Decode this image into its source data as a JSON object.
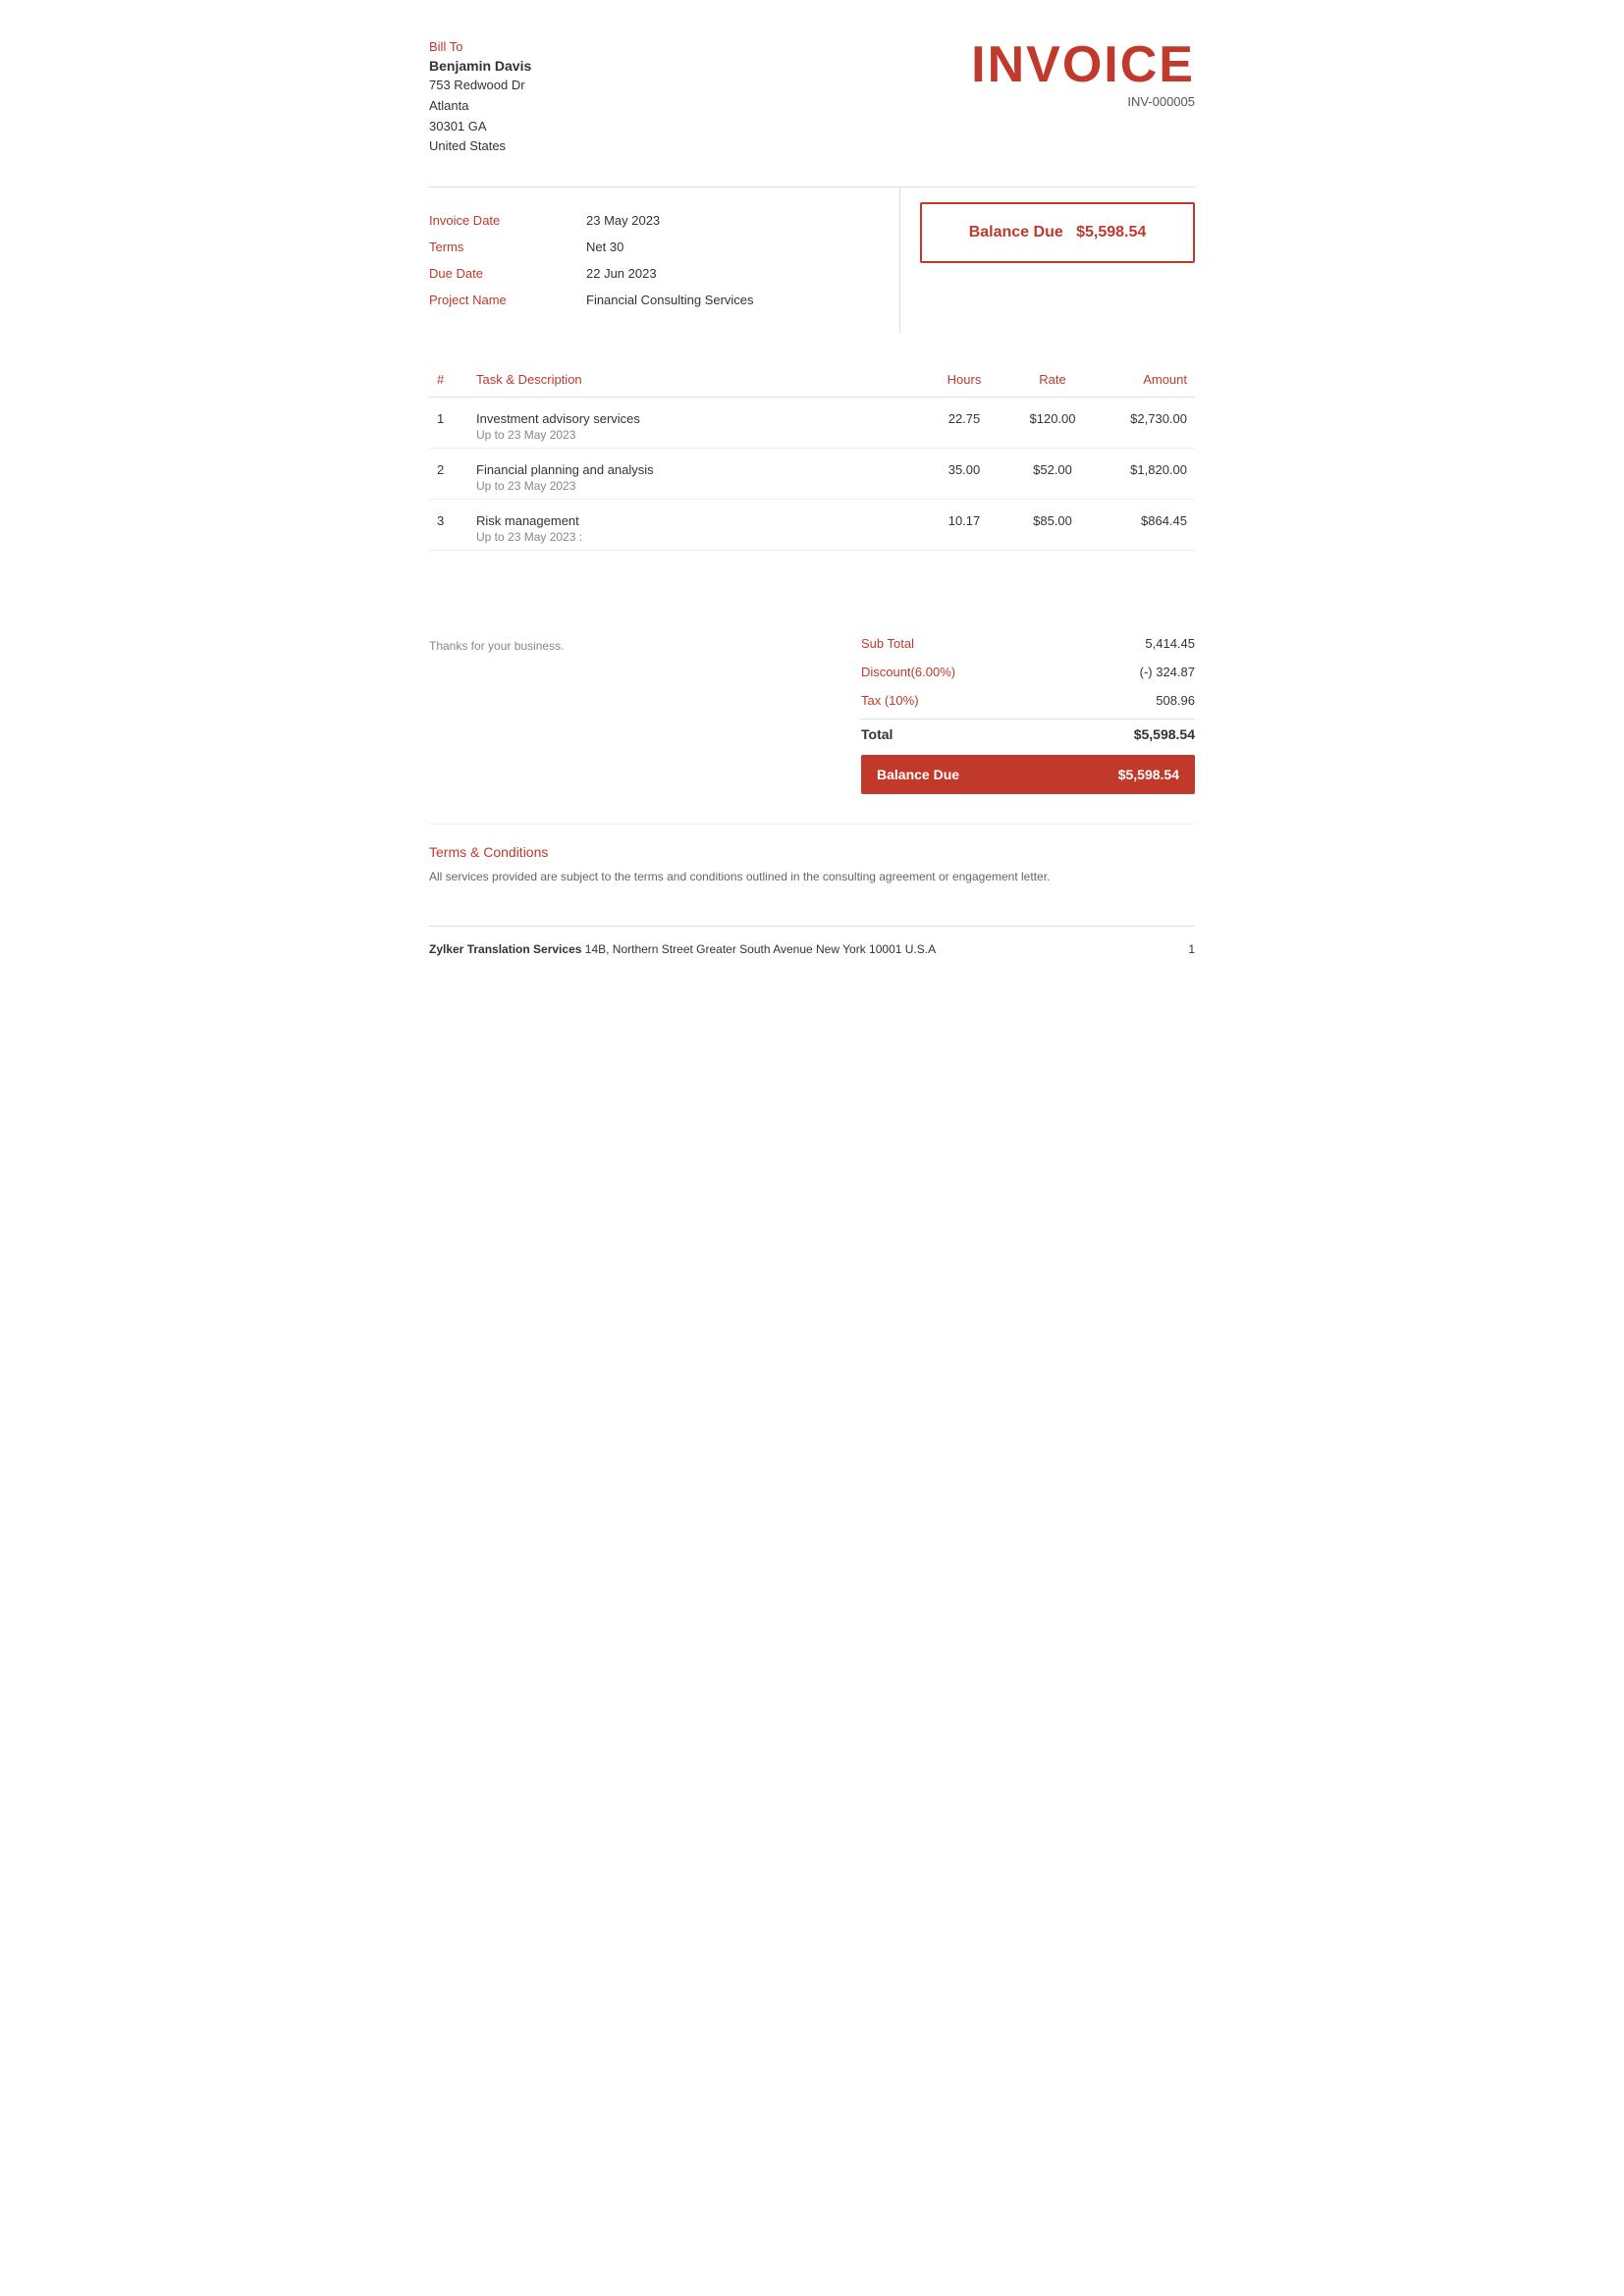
{
  "bill_to": {
    "label": "Bill To",
    "name": "Benjamin Davis",
    "address_line1": "753 Redwood Dr",
    "city": "Atlanta",
    "zip_state": "30301 GA",
    "country": "United States"
  },
  "invoice": {
    "title": "INVOICE",
    "number": "INV-000005"
  },
  "info": {
    "invoice_date_label": "Invoice Date",
    "invoice_date_value": "23 May 2023",
    "terms_label": "Terms",
    "terms_value": "Net 30",
    "due_date_label": "Due Date",
    "due_date_value": "22 Jun 2023",
    "project_name_label": "Project Name",
    "project_name_value": "Financial Consulting Services"
  },
  "balance_due": {
    "label": "Balance Due",
    "amount": "$5,598.54"
  },
  "table": {
    "col_hash": "#",
    "col_desc": "Task & Description",
    "col_hours": "Hours",
    "col_rate": "Rate",
    "col_amount": "Amount",
    "items": [
      {
        "num": "1",
        "title": "Investment advisory services",
        "subtitle": "Up to 23 May 2023",
        "hours": "22.75",
        "rate": "$120.00",
        "amount": "$2,730.00"
      },
      {
        "num": "2",
        "title": "Financial planning and analysis",
        "subtitle": "Up to 23 May 2023",
        "hours": "35.00",
        "rate": "$52.00",
        "amount": "$1,820.00"
      },
      {
        "num": "3",
        "title": "Risk management",
        "subtitle": "Up to 23 May 2023 :",
        "hours": "10.17",
        "rate": "$85.00",
        "amount": "$864.45"
      }
    ]
  },
  "footer": {
    "thanks": "Thanks for your business.",
    "sub_total_label": "Sub Total",
    "sub_total_value": "5,414.45",
    "discount_label": "Discount(6.00%)",
    "discount_value": "(-) 324.87",
    "tax_label": "Tax (10%)",
    "tax_value": "508.96",
    "total_label": "Total",
    "total_value": "$5,598.54",
    "balance_due_label": "Balance Due",
    "balance_due_value": "$5,598.54"
  },
  "terms": {
    "title": "Terms & Conditions",
    "text": "All services provided are subject to the terms and conditions outlined in the consulting agreement or engagement letter."
  },
  "page_footer": {
    "company_name": "Zylker Translation Services",
    "company_address": "14B, Northern Street Greater South Avenue New York 10001 U.S.A",
    "page_number": "1"
  }
}
